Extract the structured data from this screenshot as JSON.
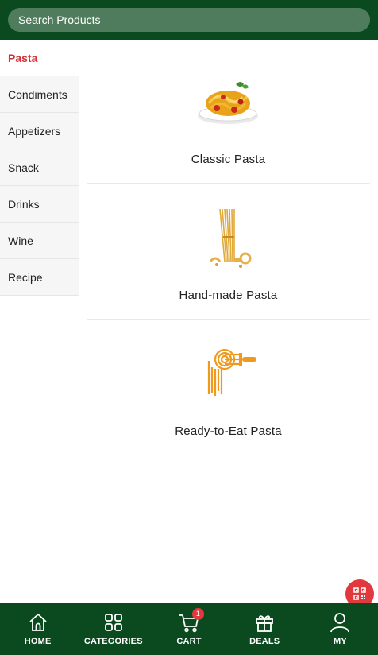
{
  "search": {
    "placeholder": "Search Products"
  },
  "sidebar": {
    "items": [
      {
        "label": "Pasta",
        "active": true
      },
      {
        "label": "Condiments"
      },
      {
        "label": "Appetizers"
      },
      {
        "label": "Snack"
      },
      {
        "label": "Drinks"
      },
      {
        "label": "Wine"
      },
      {
        "label": "Recipe"
      }
    ]
  },
  "categories": [
    {
      "label": "Classic Pasta",
      "icon": "spaghetti-plate-icon"
    },
    {
      "label": "Hand-made Pasta",
      "icon": "dry-pasta-bundle-icon"
    },
    {
      "label": "Ready-to-Eat Pasta",
      "icon": "noodle-fork-icon"
    }
  ],
  "nav": {
    "items": [
      {
        "label": "HOME",
        "icon": "home-icon"
      },
      {
        "label": "CATEGORIES",
        "icon": "grid-icon"
      },
      {
        "label": "CART",
        "icon": "cart-icon",
        "badge": "1"
      },
      {
        "label": "DEALS",
        "icon": "gift-icon"
      },
      {
        "label": "MY",
        "icon": "user-icon"
      }
    ]
  },
  "colors": {
    "brand": "#0b4a1e",
    "accent": "#d1323a",
    "badge": "#e2393e"
  }
}
